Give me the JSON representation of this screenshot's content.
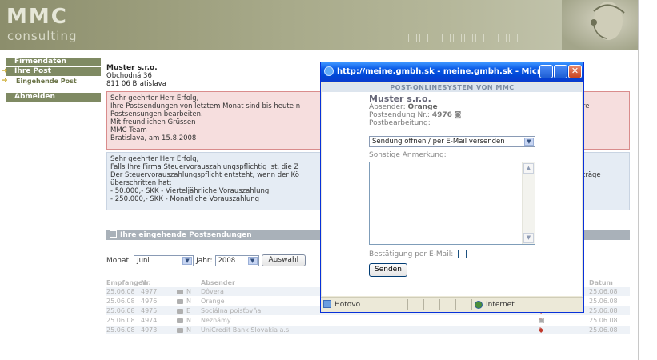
{
  "header": {
    "logo_line1": "MMC",
    "logo_line2": "consulting"
  },
  "sidebar": {
    "items": [
      {
        "label": "Firmendaten"
      },
      {
        "label": "Ihre Post"
      },
      {
        "label": "Eingehende Post"
      },
      {
        "label": "Abmelden"
      }
    ]
  },
  "address": {
    "company": "Muster s.r.o.",
    "street": "Obchodná 36",
    "city": "811 06 Bratislava"
  },
  "notice_red": {
    "line1": "Sehr geehrter Herr Erfolg,",
    "line2": "Ihre Postsendungen von letztem Monat sind bis heute n",
    "line2_right": "re",
    "line3": "Postsensungen bearbeiten.",
    "line4": "Mit freundlichen Grüssen",
    "line5": "MMC Team",
    "line6": "Bratislava, am 15.8.2008"
  },
  "notice_blue": {
    "line1": "Sehr geehrter Herr Erfolg,",
    "line2": "Falls Ihre Firma Steuervorauszahlungspflichtig ist, die Z",
    "line3": "Der Steuervorauszahlungspflicht entsteht, wenn der Kö",
    "line3_right": "träge",
    "line4": "überschritten hat:",
    "line5": "- 50.000,- SKK - Vierteljährliche Vorauszahlung",
    "line6": "- 250.000,- SKK - Monatliche Vorauszahlung"
  },
  "section_title": "Ihre eingehende Postsendungen",
  "filter": {
    "month_label": "Monat:",
    "month_value": "Juni",
    "year_label": "Jahr:",
    "year_value": "2008",
    "button": "Auswahl"
  },
  "table": {
    "headers": {
      "received": "Empfangen",
      "nr": "Nr.",
      "sender": "Absender",
      "date": "Datum"
    },
    "rows": [
      {
        "received": "25.06.08",
        "nr": "4977",
        "flag": "N",
        "sender": "Dôvera",
        "date": "25.06.08"
      },
      {
        "received": "25.06.08",
        "nr": "4976",
        "flag": "N",
        "sender": "Orange",
        "date": "25.06.08"
      },
      {
        "received": "25.06.08",
        "nr": "4975",
        "flag": "E",
        "sender": "Sociálna poisťovňa",
        "date": "25.06.08"
      },
      {
        "received": "25.06.08",
        "nr": "4974",
        "flag": "N",
        "sender": "Neznámy",
        "date": "25.06.08"
      },
      {
        "received": "25.06.08",
        "nr": "4973",
        "flag": "N",
        "sender": "UniCredit Bank Slovakia a.s.",
        "date": "25.06.08"
      }
    ]
  },
  "popup": {
    "title": "http://meine.gmbh.sk - meine.gmbh.sk - Micr...",
    "heading": "POST-ONLINESYSTEM VON MMC",
    "company": "Muster s.r.o.",
    "sender_label": "Absender:",
    "sender_value": "Orange",
    "shipment_label": "Postsendung Nr.:",
    "shipment_value": "4976",
    "processing_label": "Postbearbeitung:",
    "processing_value": "Sendung öffnen / per E-Mail versenden",
    "comment_label": "Sonstige Anmerkung:",
    "comment_value": "",
    "confirm_label": "Bestätigung per E-Mail:",
    "send_button": "Senden",
    "status_left": "Hotovo",
    "status_zone": "Internet"
  }
}
